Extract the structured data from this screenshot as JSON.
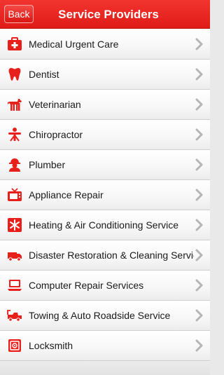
{
  "navbar": {
    "back_label": "Back",
    "title": "Service Providers"
  },
  "accent_color": "#e8201c",
  "items": [
    {
      "label": "Medical Urgent Care",
      "icon": "medical-kit-icon"
    },
    {
      "label": "Dentist",
      "icon": "tooth-icon"
    },
    {
      "label": "Veterinarian",
      "icon": "dog-icon"
    },
    {
      "label": "Chiropractor",
      "icon": "spine-icon"
    },
    {
      "label": "Plumber",
      "icon": "plumber-icon"
    },
    {
      "label": "Appliance Repair",
      "icon": "tv-icon"
    },
    {
      "label": "Heating & Air Conditioning Service",
      "icon": "snowflake-icon"
    },
    {
      "label": "Disaster Restoration & Cleaning Service",
      "icon": "truck-icon"
    },
    {
      "label": "Computer Repair Services",
      "icon": "laptop-icon"
    },
    {
      "label": "Towing & Auto Roadside Service",
      "icon": "tow-truck-icon"
    },
    {
      "label": "Locksmith",
      "icon": "safe-icon"
    }
  ]
}
